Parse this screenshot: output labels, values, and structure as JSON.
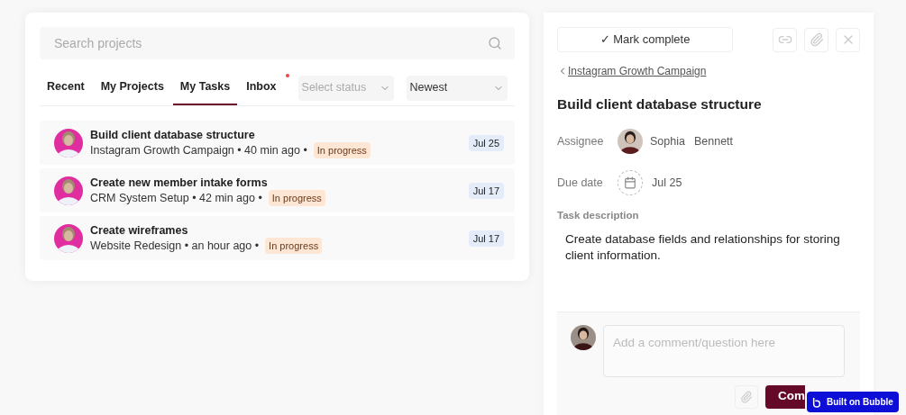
{
  "search": {
    "placeholder": "Search projects"
  },
  "tabs": [
    {
      "label": "Recent",
      "selected": false,
      "badge": false
    },
    {
      "label": "My Projects",
      "selected": false,
      "badge": false
    },
    {
      "label": "My Tasks",
      "selected": true,
      "badge": false
    },
    {
      "label": "Inbox",
      "selected": false,
      "badge": true
    }
  ],
  "filters": [
    {
      "placeholder": "Select status"
    },
    {
      "value": "Newest"
    }
  ],
  "tasks": [
    {
      "title": "Build client database structure",
      "meta": "Instagram Growth Campaign • 40 min ago •",
      "status": "In progress",
      "due": "Jul 25"
    },
    {
      "title": "Create new member intake forms",
      "meta": "CRM System Setup • 42 min ago •",
      "status": "In progress",
      "due": "Jul 17"
    },
    {
      "title": "Create wireframes",
      "meta": "Website Redesign • an hour ago •",
      "status": "In progress",
      "due": "Jul 17"
    }
  ],
  "detail": {
    "mark_complete": "✓ Mark complete",
    "back_link": "Instagram Growth Campaign",
    "title": "Build client database structure",
    "assignee_label": "Assignee",
    "assignee_first": "Sophia",
    "assignee_last": "Bennett",
    "due_label": "Due date",
    "due": "Jul 25",
    "description_label": "Task description",
    "description": "Create database fields and relationships for storing client information.",
    "comment": {
      "placeholder": "Add a comment/question here"
    },
    "comment_button": "Com"
  },
  "badge": {
    "label": "Built on Bubble"
  }
}
